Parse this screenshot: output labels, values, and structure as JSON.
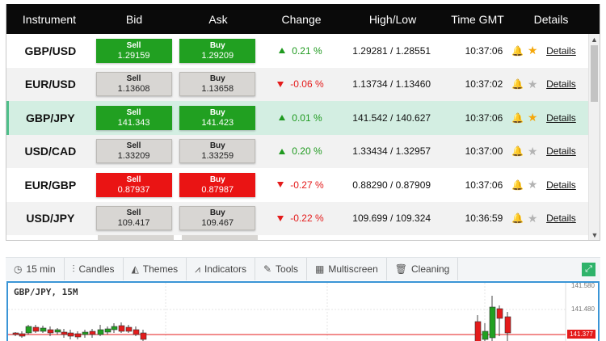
{
  "table": {
    "headers": {
      "instrument": "Instrument",
      "bid": "Bid",
      "ask": "Ask",
      "change": "Change",
      "high_low": "High/Low",
      "time": "Time GMT",
      "details": "Details"
    },
    "rows": [
      {
        "instrument": "GBP/USD",
        "sell_label": "Sell",
        "sell": "1.29159",
        "buy_label": "Buy",
        "buy": "1.29209",
        "direction": "up",
        "change": "0.21 %",
        "high_low": "1.29281 / 1.28551",
        "time": "10:37:06",
        "favorite": true,
        "details": "Details",
        "bid_style": "green",
        "ask_style": "green"
      },
      {
        "instrument": "EUR/USD",
        "sell_label": "Sell",
        "sell": "1.13608",
        "buy_label": "Buy",
        "buy": "1.13658",
        "direction": "down",
        "change": "-0.06 %",
        "high_low": "1.13734 / 1.13460",
        "time": "10:37:02",
        "favorite": false,
        "details": "Details",
        "bid_style": "grey",
        "ask_style": "grey"
      },
      {
        "instrument": "GBP/JPY",
        "sell_label": "Sell",
        "sell": "141.343",
        "buy_label": "Buy",
        "buy": "141.423",
        "direction": "up",
        "change": "0.01 %",
        "high_low": "141.542 / 140.627",
        "time": "10:37:06",
        "favorite": true,
        "details": "Details",
        "bid_style": "green",
        "ask_style": "green"
      },
      {
        "instrument": "USD/CAD",
        "sell_label": "Sell",
        "sell": "1.33209",
        "buy_label": "Buy",
        "buy": "1.33259",
        "direction": "up",
        "change": "0.20 %",
        "high_low": "1.33434 / 1.32957",
        "time": "10:37:00",
        "favorite": false,
        "details": "Details",
        "bid_style": "grey",
        "ask_style": "grey"
      },
      {
        "instrument": "EUR/GBP",
        "sell_label": "Sell",
        "sell": "0.87937",
        "buy_label": "Buy",
        "buy": "0.87987",
        "direction": "down",
        "change": "-0.27 %",
        "high_low": "0.88290 / 0.87909",
        "time": "10:37:06",
        "favorite": false,
        "details": "Details",
        "bid_style": "red",
        "ask_style": "red"
      },
      {
        "instrument": "USD/JPY",
        "sell_label": "Sell",
        "sell": "109.417",
        "buy_label": "Buy",
        "buy": "109.467",
        "direction": "down",
        "change": "-0.22 %",
        "high_low": "109.699 / 109.324",
        "time": "10:36:59",
        "favorite": false,
        "details": "Details",
        "bid_style": "grey",
        "ask_style": "grey"
      }
    ],
    "selected_row": 2
  },
  "toolbar": {
    "timeframe": "15 min",
    "candles": "Candles",
    "themes": "Themes",
    "indicators": "Indicators",
    "tools": "Tools",
    "multiscreen": "Multiscreen",
    "cleaning": "Cleaning"
  },
  "chart": {
    "title": "GBP/JPY, 15M",
    "price_top": "141.580",
    "price_mid": "141.480",
    "last_price": "141.377",
    "colors": {
      "up": "#21a021",
      "down": "#e41b1b",
      "last_line": "#e41b1b",
      "frame": "#3a95d6"
    }
  }
}
